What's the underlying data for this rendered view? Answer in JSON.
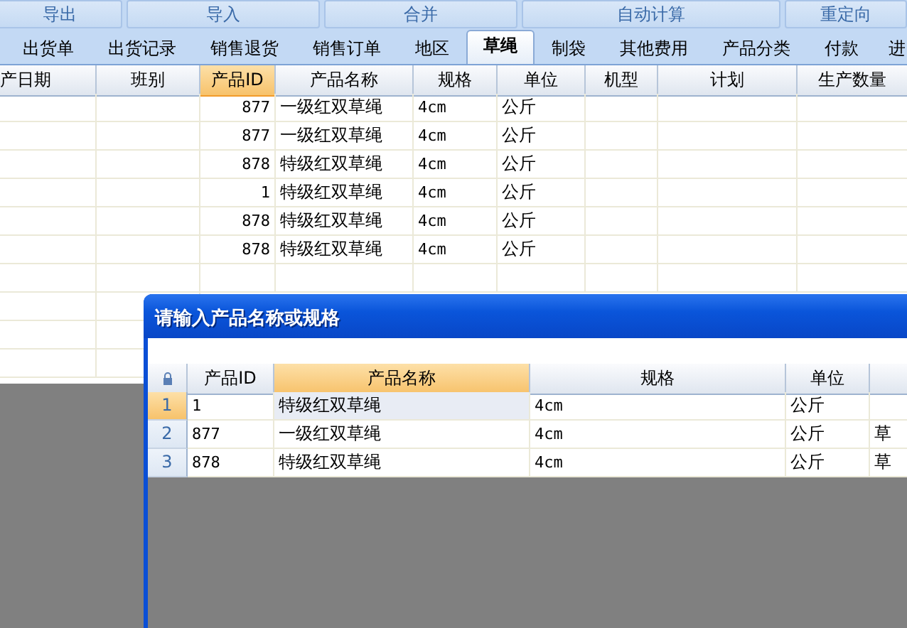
{
  "toolbar": [
    "导出",
    "导入",
    "合并",
    "自动计算",
    "重定向"
  ],
  "tabs": [
    {
      "label": "出货单",
      "selected": false
    },
    {
      "label": "出货记录",
      "selected": false
    },
    {
      "label": "销售退货",
      "selected": false
    },
    {
      "label": "销售订单",
      "selected": false
    },
    {
      "label": "地区",
      "selected": false
    },
    {
      "label": "草绳",
      "selected": true
    },
    {
      "label": "制袋",
      "selected": false
    },
    {
      "label": "其他费用",
      "selected": false
    },
    {
      "label": "产品分类",
      "selected": false
    },
    {
      "label": "付款",
      "selected": false
    },
    {
      "label": "进",
      "selected": false
    }
  ],
  "grid": {
    "columns": [
      {
        "label": "产日期",
        "selected": false
      },
      {
        "label": "班别",
        "selected": false
      },
      {
        "label": "产品ID",
        "selected": true
      },
      {
        "label": "产品名称",
        "selected": false
      },
      {
        "label": "规格",
        "selected": false
      },
      {
        "label": "单位",
        "selected": false
      },
      {
        "label": "机型",
        "selected": false
      },
      {
        "label": "计划",
        "selected": false
      },
      {
        "label": "生产数量",
        "selected": false
      }
    ],
    "rows": [
      [
        "",
        "",
        "877",
        "一级红双草绳",
        "4cm",
        "公斤",
        "",
        "",
        ""
      ],
      [
        "",
        "",
        "877",
        "一级红双草绳",
        "4cm",
        "公斤",
        "",
        "",
        ""
      ],
      [
        "",
        "",
        "878",
        "特级红双草绳",
        "4cm",
        "公斤",
        "",
        "",
        ""
      ],
      [
        "",
        "",
        "1",
        "特级红双草绳",
        "4cm",
        "公斤",
        "",
        "",
        ""
      ],
      [
        "",
        "",
        "878",
        "特级红双草绳",
        "4cm",
        "公斤",
        "",
        "",
        ""
      ],
      [
        "",
        "",
        "878",
        "特级红双草绳",
        "4cm",
        "公斤",
        "",
        "",
        ""
      ]
    ]
  },
  "dialog": {
    "title": "请输入产品名称或规格",
    "columns": [
      {
        "label": "产品ID",
        "selected": false
      },
      {
        "label": "产品名称",
        "selected": true
      },
      {
        "label": "规格",
        "selected": false
      },
      {
        "label": "单位",
        "selected": false
      },
      {
        "selected": false
      }
    ],
    "rows": [
      {
        "number": "1",
        "selected": true,
        "cells": [
          "1",
          "特级红双草绳",
          "4cm",
          "公斤",
          ""
        ]
      },
      {
        "number": "2",
        "selected": false,
        "cells": [
          "877",
          "一级红双草绳",
          "4cm",
          "公斤",
          "草"
        ]
      },
      {
        "number": "3",
        "selected": false,
        "cells": [
          "878",
          "特级红双草绳",
          "4cm",
          "公斤",
          "草"
        ]
      }
    ]
  }
}
